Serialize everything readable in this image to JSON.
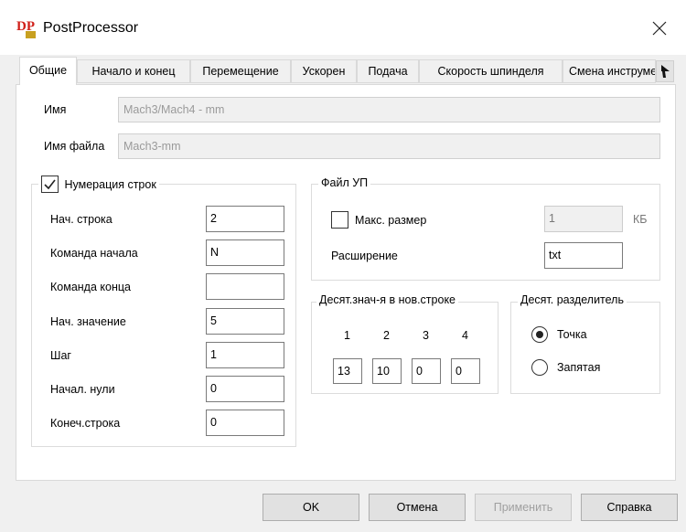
{
  "window": {
    "title": "PostProcessor",
    "logo_text": "DP"
  },
  "tabs": [
    "Общие",
    "Начало и конец",
    "Перемещение",
    "Ускорен",
    "Подача",
    "Скорость шпинделя",
    "Смена инструмента"
  ],
  "general": {
    "name_label": "Имя",
    "name_value": "Mach3/Mach4 - mm",
    "filename_label": "Имя файла",
    "filename_value": "Mach3-mm"
  },
  "line_numbering": {
    "title": "Нумерация строк",
    "checked": true,
    "rows": [
      {
        "label": "Нач. строка",
        "value": "2"
      },
      {
        "label": "Команда начала",
        "value": "N"
      },
      {
        "label": "Команда конца",
        "value": ""
      },
      {
        "label": "Нач. значение",
        "value": "5"
      },
      {
        "label": "Шаг",
        "value": "1"
      },
      {
        "label": "Начал. нули",
        "value": "0"
      },
      {
        "label": "Конеч.строка",
        "value": "0"
      }
    ]
  },
  "nc_file": {
    "title": "Файл УП",
    "max_size_label": "Макс. размер",
    "max_size_checked": false,
    "max_size_value": "1",
    "max_size_unit": "КБ",
    "extension_label": "Расширение",
    "extension_value": "txt"
  },
  "decimals": {
    "title": "Десят.знач-я в нов.строке",
    "headers": [
      "1",
      "2",
      "3",
      "4"
    ],
    "values": [
      "13",
      "10",
      "0",
      "0"
    ]
  },
  "separator": {
    "title": "Десят. разделитель",
    "options": [
      "Точка",
      "Запятая"
    ],
    "selected": "Точка"
  },
  "buttons": {
    "ok": "OK",
    "cancel": "Отмена",
    "apply": "Применить",
    "help": "Справка"
  },
  "colors": {
    "logo_red": "#d0201a",
    "logo_gold": "#c8a020"
  }
}
